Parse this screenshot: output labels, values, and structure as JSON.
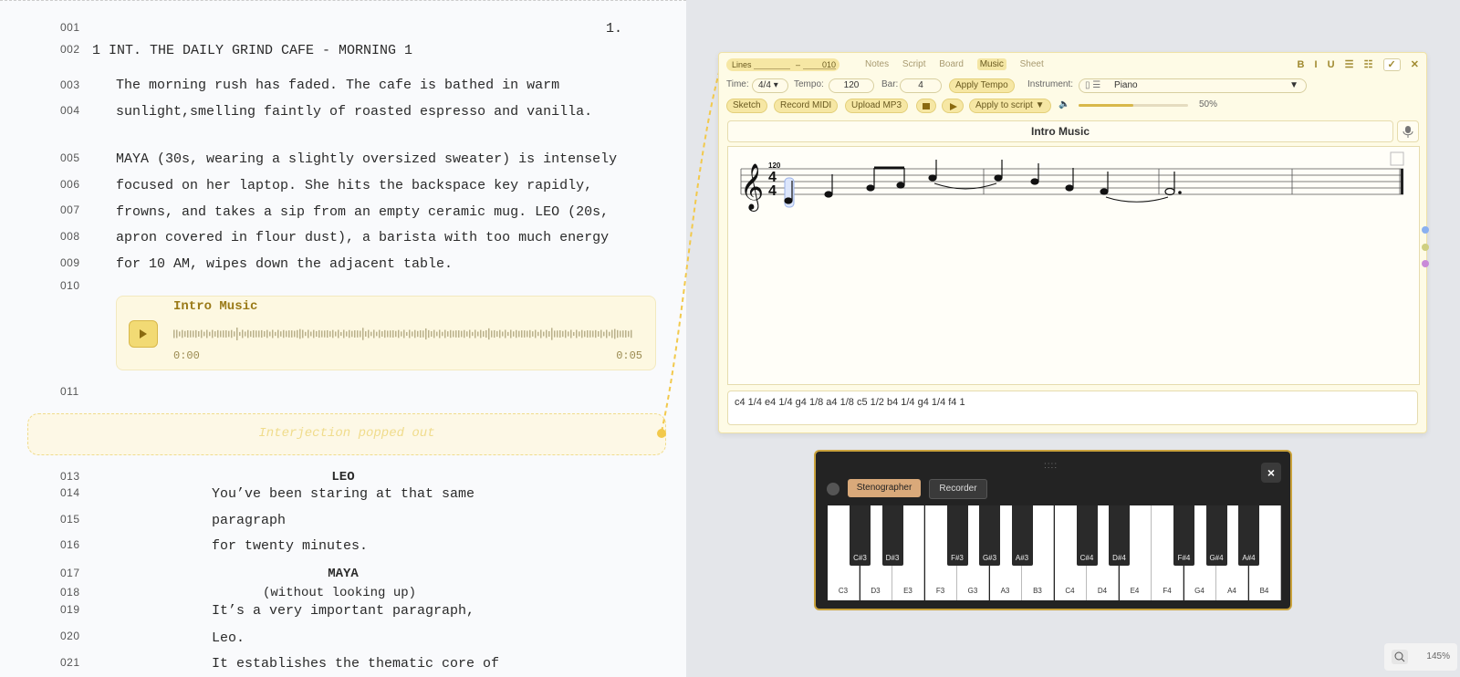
{
  "script": {
    "page_number": "1.",
    "line_numbers": [
      "001",
      "002",
      "003",
      "004",
      "005",
      "006",
      "007",
      "008",
      "009",
      "010",
      "011",
      "013",
      "014",
      "015",
      "016",
      "017",
      "018",
      "019",
      "020",
      "021"
    ],
    "scene_heading": "1 INT. THE DAILY GRIND CAFE - MORNING 1",
    "action_1": [
      "The morning rush has faded. The cafe is bathed in warm",
      "sunlight,smelling faintly of roasted espresso and vanilla."
    ],
    "action_2": [
      "MAYA (30s, wearing a slightly oversized sweater) is intensely",
      "focused on her laptop. She hits the backspace key rapidly,",
      "frowns, and takes a sip from an empty ceramic mug. LEO (20s,",
      "apron covered in flour dust), a barista with too much energy",
      "for 10 AM, wipes down the adjacent table."
    ],
    "audio": {
      "title": "Intro Music",
      "time_start": "0:00",
      "time_end": "0:05"
    },
    "interjection": "Interjection popped out",
    "character_1": "LEO",
    "dialogue_1": [
      "You’ve been staring at that same",
      "paragraph",
      "for twenty minutes."
    ],
    "character_2": "MAYA",
    "parenthetical_2": "(without looking up)",
    "dialogue_2": [
      "It’s a very important paragraph,",
      "Leo.",
      "It establishes the thematic core of"
    ]
  },
  "music_panel": {
    "lines_label": "Lines",
    "lines_dash": "–",
    "lines_to": "010",
    "tabs": [
      "Notes",
      "Script",
      "Board",
      "Music",
      "Sheet"
    ],
    "active_tab": "Music",
    "format_buttons": [
      "B",
      "I",
      "U",
      "☰",
      "☷",
      "✓",
      "✕"
    ],
    "time_label": "Time:",
    "time_value": "4/4",
    "tempo_label": "Tempo:",
    "tempo_value": "120",
    "bar_label": "Bar:",
    "bar_value": "4",
    "apply_tempo": "Apply Tempo",
    "instrument_label": "Instrument:",
    "instrument_value": "Piano",
    "sketch": "Sketch",
    "record_midi": "Record MIDI",
    "upload_mp3": "Upload MP3",
    "apply_to_script": "Apply to script",
    "volume_percent": "50%",
    "volume_level": 0.5,
    "title": "Intro Music",
    "staff_tempo": "120",
    "note_sequence": "c4 1/4 e4 1/4 g4 1/8 a4 1/8  c5 1/2 b4 1/4 g4 1/4   f4 1"
  },
  "keyboard": {
    "grip": "::::",
    "mode_active": "Stenographer",
    "mode_other": "Recorder",
    "close": "×",
    "white_keys": [
      "C3",
      "D3",
      "E3",
      "F3",
      "G3",
      "A3",
      "B3",
      "C4",
      "D4",
      "E4",
      "F4",
      "G4",
      "A4",
      "B4"
    ],
    "black_keys": [
      "C#3",
      "D#3",
      "F#3",
      "G#3",
      "A#3",
      "C#4",
      "D#4",
      "F#4",
      "G#4",
      "A#4"
    ]
  },
  "zoom": {
    "value": "145%"
  },
  "colors": {
    "accent_yellow": "#f2c94c",
    "panel_bg": "#fefbe6",
    "keyboard_border": "#c9a23c",
    "stenographer": "#d9a97a"
  }
}
